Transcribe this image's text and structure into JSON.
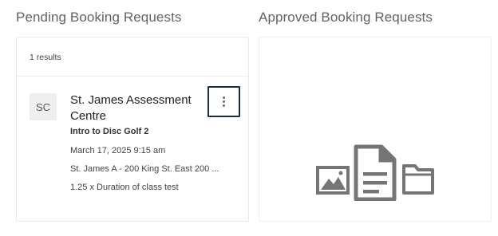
{
  "pending": {
    "title": "Pending Booking Requests",
    "results_count": "1 results",
    "bookings": [
      {
        "avatar_initials": "SC",
        "title": "St. James Assessment Centre",
        "class_name": "Intro to Disc Golf 2",
        "date": "March 17, 2025 9:15 am",
        "location": "St. James A - 200 King St. East 200 ...",
        "duration": "1.25 x Duration of class test",
        "menu_icon": "more-vert-icon"
      }
    ]
  },
  "approved": {
    "title": "Approved Booking Requests",
    "empty_icon": "empty-files-illustration-icon"
  },
  "colors": {
    "title_text": "#5f6368",
    "panel_border": "#e8e8e8",
    "focus_outline": "#1b2b3a",
    "avatar_bg": "#eeeeee",
    "illustration": "#757575"
  }
}
